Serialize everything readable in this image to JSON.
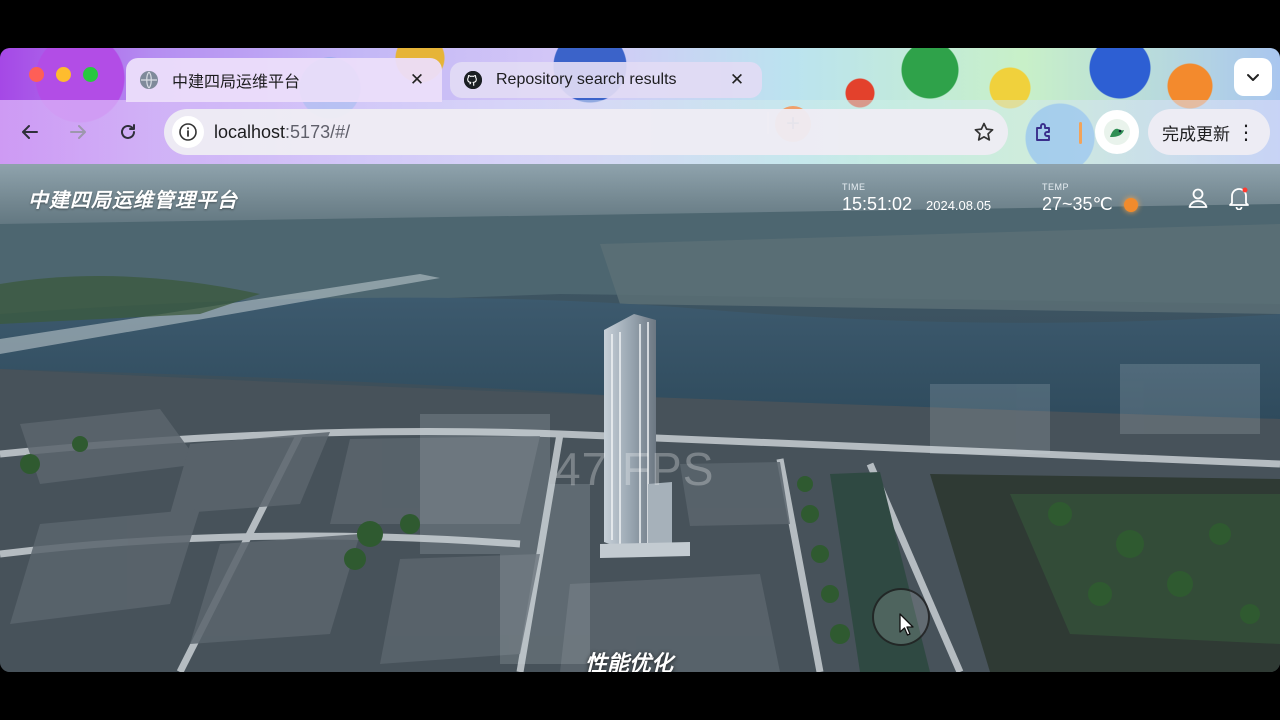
{
  "browser": {
    "tabs": [
      {
        "title": "中建四局运维平台",
        "favicon": "globe-icon",
        "active": true
      },
      {
        "title": "Repository search results",
        "favicon": "github-icon",
        "active": false
      }
    ],
    "close_glyph": "✕",
    "new_tab_glyph": "+",
    "address": {
      "host": "localhost",
      "path": ":5173/#/"
    },
    "update_label": "完成更新",
    "kebab_glyph": "⋮",
    "icons": {
      "back": "back-arrow-icon",
      "forward": "forward-arrow-icon",
      "reload": "reload-icon",
      "info": "site-info-icon",
      "bookmark": "star-icon",
      "extensions": "puzzle-icon",
      "profile": "profile-avatar-icon",
      "tab_menu": "chevron-down-icon"
    }
  },
  "app": {
    "title": "中建四局运维管理平台",
    "time_label": "TIME",
    "time": "15:51:02",
    "date": "2024.08.05",
    "temp_label": "TEMP",
    "temp": "27~35℃",
    "weather_icon": "sun-icon",
    "user_icon": "user-icon",
    "bell_icon": "bell-icon",
    "fps": "47 FPS",
    "caption": "性能优化"
  }
}
